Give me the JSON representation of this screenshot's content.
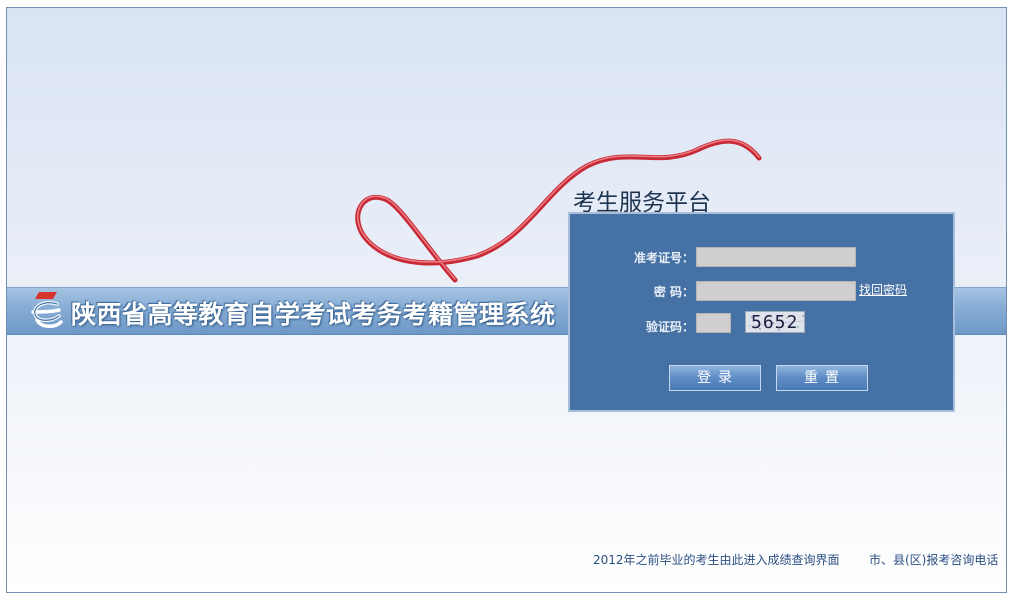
{
  "header": {
    "system_title": "陕西省高等教育自学考试考务考籍管理系统",
    "logo_icon": "shaanxi-education-logo-icon"
  },
  "login": {
    "platform_title": "考生服务平台",
    "admission_label": "准考证号：",
    "admission_value": "",
    "password_label": "密 码：",
    "password_value": "",
    "find_password_link": "找回密码",
    "captcha_label": "验证码：",
    "captcha_value": "",
    "captcha_text": "5652",
    "login_button": "登录",
    "reset_button": "重置"
  },
  "footer": {
    "score_query_link": "2012年之前毕业的考生由此进入成绩查询界面",
    "consult_phone_link": "市、县(区)报考咨询电话"
  },
  "colors": {
    "panel_bg": "#4671a4",
    "banner": "#89aed6",
    "ribbon": "#d0303c",
    "link": "#2c4f82"
  }
}
